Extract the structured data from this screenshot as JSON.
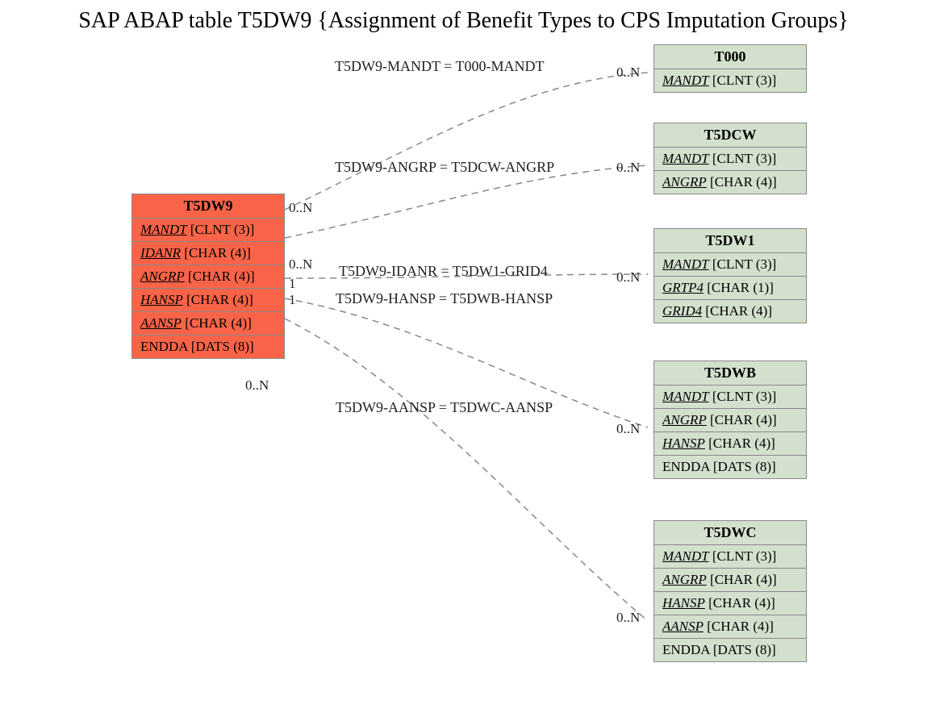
{
  "title": "SAP ABAP table T5DW9 {Assignment of Benefit Types to CPS Imputation Groups}",
  "main": {
    "name": "T5DW9",
    "fields": [
      {
        "key": "MANDT",
        "type": "[CLNT (3)]",
        "isKey": true
      },
      {
        "key": "IDANR",
        "type": "[CHAR (4)]",
        "isKey": true
      },
      {
        "key": "ANGRP",
        "type": "[CHAR (4)]",
        "isKey": true
      },
      {
        "key": "HANSP",
        "type": "[CHAR (4)]",
        "isKey": true
      },
      {
        "key": "AANSP",
        "type": "[CHAR (4)]",
        "isKey": true
      },
      {
        "key": "ENDDA",
        "type": "[DATS (8)]",
        "isKey": false
      }
    ]
  },
  "related": [
    {
      "name": "T000",
      "fields": [
        {
          "key": "MANDT",
          "type": "[CLNT (3)]",
          "isKey": true
        }
      ]
    },
    {
      "name": "T5DCW",
      "fields": [
        {
          "key": "MANDT",
          "type": "[CLNT (3)]",
          "isKey": true
        },
        {
          "key": "ANGRP",
          "type": "[CHAR (4)]",
          "isKey": true
        }
      ]
    },
    {
      "name": "T5DW1",
      "fields": [
        {
          "key": "MANDT",
          "type": "[CLNT (3)]",
          "isKey": true
        },
        {
          "key": "GRTP4",
          "type": "[CHAR (1)]",
          "isKey": true
        },
        {
          "key": "GRID4",
          "type": "[CHAR (4)]",
          "isKey": true
        }
      ]
    },
    {
      "name": "T5DWB",
      "fields": [
        {
          "key": "MANDT",
          "type": "[CLNT (3)]",
          "isKey": true
        },
        {
          "key": "ANGRP",
          "type": "[CHAR (4)]",
          "isKey": true
        },
        {
          "key": "HANSP",
          "type": "[CHAR (4)]",
          "isKey": true
        },
        {
          "key": "ENDDA",
          "type": "[DATS (8)]",
          "isKey": false
        }
      ]
    },
    {
      "name": "T5DWC",
      "fields": [
        {
          "key": "MANDT",
          "type": "[CLNT (3)]",
          "isKey": true
        },
        {
          "key": "ANGRP",
          "type": "[CHAR (4)]",
          "isKey": true
        },
        {
          "key": "HANSP",
          "type": "[CHAR (4)]",
          "isKey": true
        },
        {
          "key": "AANSP",
          "type": "[CHAR (4)]",
          "isKey": true
        },
        {
          "key": "ENDDA",
          "type": "[DATS (8)]",
          "isKey": false
        }
      ]
    }
  ],
  "edges": [
    {
      "label": "T5DW9-MANDT = T000-MANDT",
      "leftCard": "0..N",
      "rightCard": "0..N"
    },
    {
      "label": "T5DW9-ANGRP = T5DCW-ANGRP",
      "leftCard": "0..N",
      "rightCard": "0..N"
    },
    {
      "label": "T5DW9-IDANR = T5DW1-GRID4",
      "leftCard": "1",
      "rightCard": "0..N"
    },
    {
      "label": "T5DW9-HANSP = T5DWB-HANSP",
      "leftCard": "1",
      "rightCard": ""
    },
    {
      "label": "T5DW9-AANSP = T5DWC-AANSP",
      "leftCard": "0..N",
      "rightCard": "0..N"
    },
    {
      "label": "",
      "leftCard": "",
      "rightCard": "0..N"
    }
  ]
}
